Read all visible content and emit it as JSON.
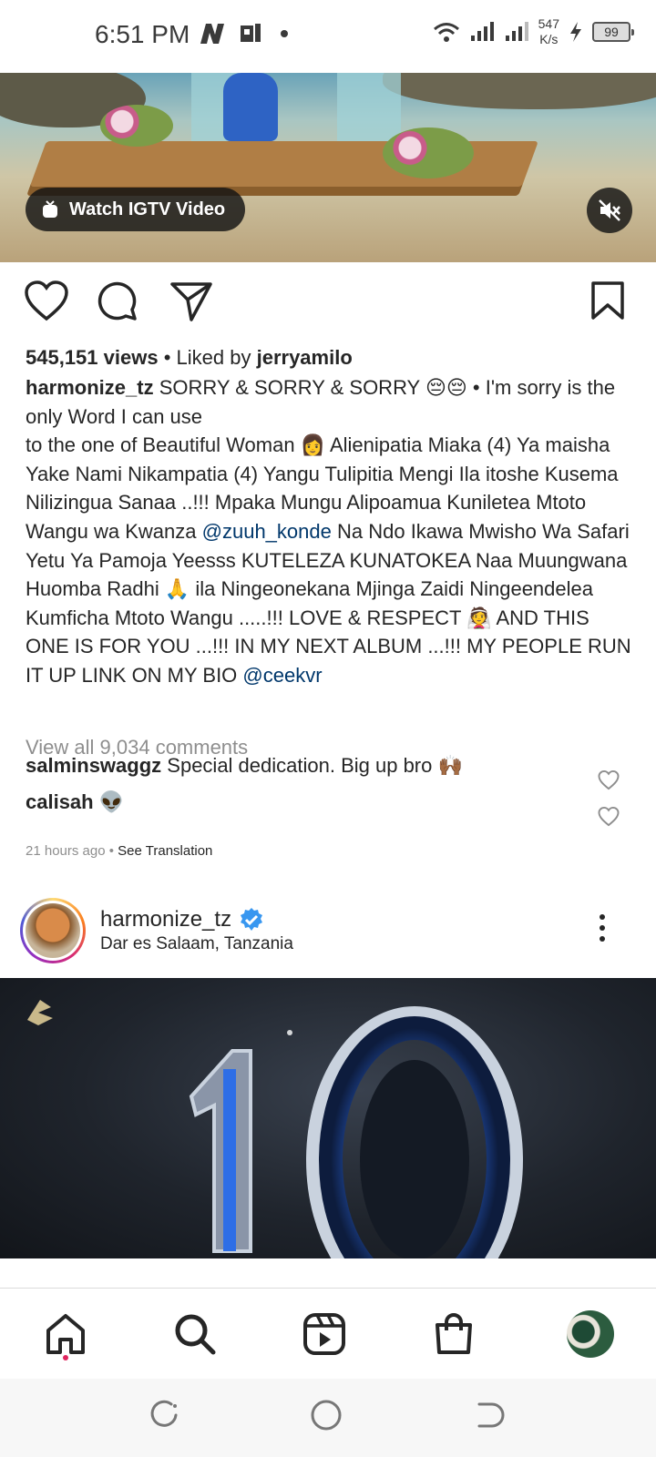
{
  "status_bar": {
    "time": "6:51 PM",
    "net_speed_value": "547",
    "net_speed_unit": "K/s",
    "battery": "99"
  },
  "top_post": {
    "igtv_label": "Watch IGTV Video",
    "views": "545,151 views",
    "liked_by_prefix": "• Liked by",
    "liked_by_user": "jerryamilo",
    "caption_user": "harmonize_tz",
    "caption_part1": "SORRY & SORRY & SORRY 😔😔 • I'm sorry is the only Word I can use",
    "caption_part2": "to the one of Beautiful Woman 👩  Alienipatia Miaka (4) Ya maisha Yake Nami Nikampatia (4) Yangu Tulipitia Mengi Ila itoshe Kusema Nilizingua Sanaa ..!!! Mpaka Mungu Alipoamua Kuniletea Mtoto Wangu wa Kwanza",
    "mention1": "@zuuh_konde",
    "caption_part3": "Na Ndo Ikawa Mwisho Wa Safari Yetu Ya Pamoja Yeesss KUTELEZA KUNATOKEA Naa Muungwana Huomba Radhi 🙏 ila Ningeonekana Mjinga Zaidi Ningeendelea Kumficha Mtoto Wangu .....!!! LOVE & RESPECT 👰 AND THIS ONE IS FOR YOU ...!!! IN MY NEXT ALBUM ...!!! MY PEOPLE RUN IT UP LINK ON MY BIO",
    "mention2": "@ceekvr",
    "view_all_comments": "View all 9,034 comments",
    "comments": [
      {
        "user": "salminswaggz",
        "text": "Special dedication. Big up bro 🙌🏾"
      },
      {
        "user": "calisah",
        "text": "👽"
      }
    ],
    "time_ago": "21 hours ago",
    "see_translation": "See Translation"
  },
  "next_post": {
    "username": "harmonize_tz",
    "location": "Dar es Salaam, Tanzania"
  },
  "icons": {
    "like": "heart-icon",
    "comment": "comment-icon",
    "share": "send-icon",
    "save": "bookmark-icon",
    "verified": "verified-badge-icon"
  },
  "colors": {
    "mention": "#00376b",
    "muted": "#8e8e8e",
    "verified": "#3897f0",
    "notification_dot": "#e0245e"
  }
}
